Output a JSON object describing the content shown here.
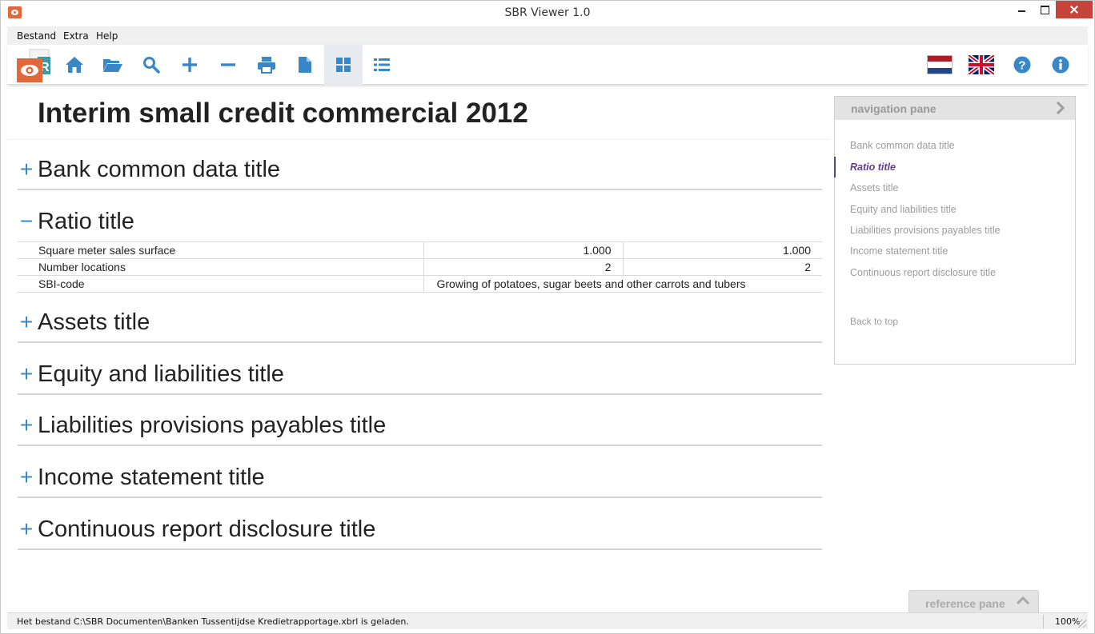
{
  "window": {
    "title": "SBR Viewer 1.0"
  },
  "menu": {
    "items": [
      "Bestand",
      "Extra",
      "Help"
    ]
  },
  "toolbar": {
    "buttons": [
      "home-icon",
      "open-folder-icon",
      "search-icon",
      "expand-all-icon",
      "collapse-all-icon",
      "print-icon",
      "document-icon",
      "grid-view-icon",
      "list-view-icon"
    ],
    "active": "grid-view-icon",
    "right_buttons": [
      "dutch-flag-icon",
      "uk-flag-icon",
      "help-icon",
      "info-icon"
    ]
  },
  "document": {
    "title": "Interim small credit commercial 2012",
    "sections": [
      {
        "label": "Bank common data title",
        "toggle": "+"
      },
      {
        "label": "Ratio title",
        "toggle": "−"
      },
      {
        "label": "Assets title",
        "toggle": "+"
      },
      {
        "label": "Equity and liabilities title",
        "toggle": "+"
      },
      {
        "label": "Liabilities provisions payables title",
        "toggle": "+"
      },
      {
        "label": "Income statement title",
        "toggle": "+"
      },
      {
        "label": "Continuous report disclosure title",
        "toggle": "+"
      }
    ],
    "ratio_rows": [
      {
        "label": "Square meter sales surface",
        "v1": "1.000",
        "v2": "1.000"
      },
      {
        "label": "Number locations",
        "v1": "2",
        "v2": "2"
      },
      {
        "label": "SBI-code",
        "text": "Growing of potatoes, sugar beets and other carrots and tubers"
      }
    ]
  },
  "navigation_pane": {
    "title": "navigation pane",
    "links": [
      "Bank common data title",
      "Ratio title",
      "Assets title",
      "Equity and liabilities title",
      "Liabilities provisions payables title",
      "Income statement title",
      "Continuous report disclosure title"
    ],
    "active": "Ratio title",
    "back_to_top": "Back to top"
  },
  "reference_pane": {
    "title": "reference pane"
  },
  "status": {
    "message": "Het bestand C:\\SBR Documenten\\Banken Tussentijdse Kredietrapportage.xbrl is geladen.",
    "zoom": "100%"
  },
  "colors": {
    "accent": "#3a87c8",
    "active_nav": "#5e3f8c",
    "close_button": "#c7443a",
    "logo_orange": "#e2683c"
  }
}
